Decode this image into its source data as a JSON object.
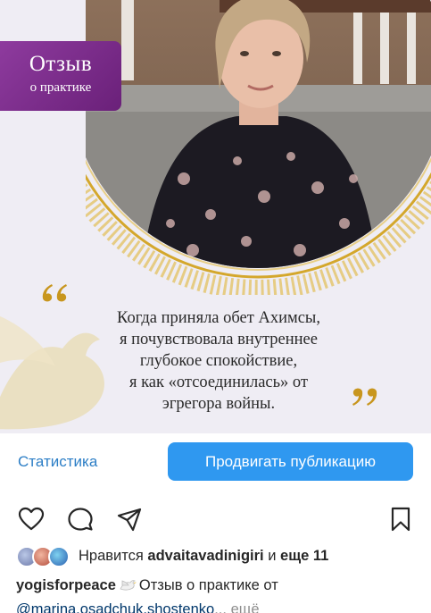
{
  "post": {
    "badge_title": "Отзыв",
    "badge_subtitle": "о практике",
    "quote_lines": [
      "Когда приняла обет Ахимсы,",
      "я почувствовала внутреннее",
      "глубокое спокойствие,",
      "я как «отсоединилась» от",
      "эгрегора войны."
    ]
  },
  "actions": {
    "stats_label": "Статистика",
    "promote_label": "Продвигать публикацию"
  },
  "icons": [
    "heart-icon",
    "comment-icon",
    "share-icon",
    "bookmark-icon"
  ],
  "likes": {
    "prefix": "Нравится",
    "user": "advaitavadinigiri",
    "joiner": "и",
    "others": "еще 11"
  },
  "caption": {
    "username": "yogisforpeace",
    "text": "Отзыв о практике от",
    "mention": "@marina.osadchuk.shostenko",
    "ellipsis": "...",
    "more_label": "ещё"
  },
  "colors": {
    "accent_blue": "#2f98f0",
    "link_blue": "#2c7ec6",
    "badge_purple": "#7a2a8a",
    "gold": "#d4a72c"
  }
}
